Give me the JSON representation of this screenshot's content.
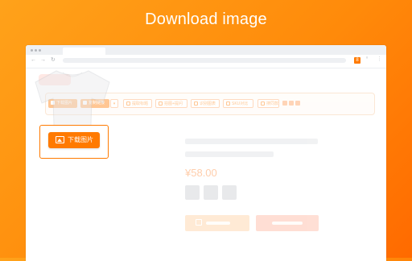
{
  "headline": "Download image",
  "browser": {
    "nav_back": "←",
    "nav_forward": "→",
    "nav_reload": "↻",
    "extension_badge": "8",
    "rss_icon": "ʶ",
    "menu_icon": "⋮"
  },
  "toolbar": {
    "items": [
      {
        "label": "下载图片",
        "style": "solid",
        "icon": "image-icon"
      },
      {
        "label": "复制链接",
        "style": "solid",
        "icon": "copy-icon"
      },
      {
        "label": "▾",
        "style": "caret",
        "icon": "chevron-down-icon"
      },
      {
        "label": "提取标题",
        "style": "outline",
        "icon": "text-icon"
      },
      {
        "label": "拍图+提问",
        "style": "outline",
        "icon": "camera-icon"
      },
      {
        "label": "识别图表",
        "style": "outline",
        "icon": "table-icon"
      },
      {
        "label": "SKU对比",
        "style": "outline",
        "icon": "compare-icon"
      },
      {
        "label": "搜同款",
        "style": "outline",
        "icon": "search-icon"
      }
    ]
  },
  "product": {
    "price": "¥58.00"
  },
  "floating_button": {
    "label": "下载图片",
    "icon": "image-icon"
  },
  "colors": {
    "accent": "#ff7a00",
    "background_start": "#ffa21a",
    "background_end": "#ff6a00"
  }
}
